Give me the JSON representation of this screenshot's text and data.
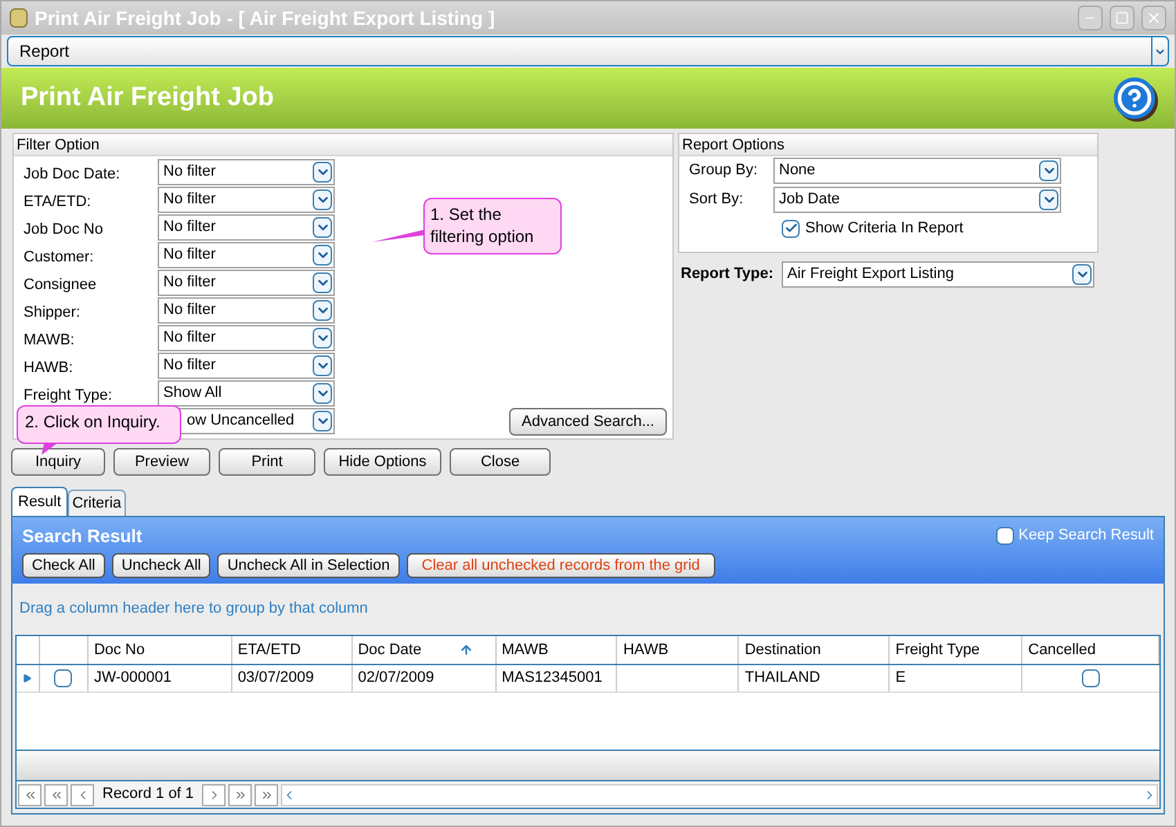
{
  "window": {
    "title": "Print Air Freight Job - [ Air Freight Export Listing ]"
  },
  "menu": {
    "value": "Report"
  },
  "banner": {
    "title": "Print Air Freight Job"
  },
  "filter_option": {
    "title": "Filter Option",
    "filters": [
      {
        "label": "Job Doc Date:",
        "value": "No filter"
      },
      {
        "label": "ETA/ETD:",
        "value": "No filter"
      },
      {
        "label": "Job Doc No",
        "value": "No filter"
      },
      {
        "label": "Customer:",
        "value": "No filter"
      },
      {
        "label": "Consignee",
        "value": "No filter"
      },
      {
        "label": "Shipper:",
        "value": "No filter"
      },
      {
        "label": "MAWB:",
        "value": "No filter"
      },
      {
        "label": "HAWB:",
        "value": "No filter"
      },
      {
        "label": "Freight Type:",
        "value": "Show All"
      },
      {
        "value": "ow Uncancelled"
      }
    ],
    "advanced_button": "Advanced Search..."
  },
  "report_options": {
    "title": "Report Options",
    "group_by": {
      "label": "Group By:",
      "value": "None"
    },
    "sort_by": {
      "label": "Sort By:",
      "value": "Job Date"
    },
    "show_criteria": {
      "label": "Show Criteria In Report",
      "checked": true
    }
  },
  "report_type": {
    "label": "Report Type:",
    "value": "Air Freight Export Listing"
  },
  "actions": [
    "Inquiry",
    "Preview",
    "Print",
    "Hide Options",
    "Close"
  ],
  "callouts": [
    {
      "text": "1. Set the filtering option"
    },
    {
      "text": "2. Click on Inquiry."
    }
  ],
  "tabs": [
    {
      "label": "Result",
      "selected": true
    },
    {
      "label": "Criteria",
      "selected": false
    }
  ],
  "search_result": {
    "title": "Search Result",
    "keep": {
      "label": "Keep Search Result",
      "checked": false
    },
    "buttons": [
      {
        "label": "Check All",
        "kind": "normal"
      },
      {
        "label": "Uncheck All",
        "kind": "normal"
      },
      {
        "label": "Uncheck All in Selection",
        "kind": "normal"
      },
      {
        "label": "Clear all unchecked records from the grid",
        "kind": "danger"
      }
    ],
    "group_hint": "Drag a column header here to group by that column",
    "table": {
      "columns": [
        {
          "label": "Doc No",
          "sorted": false
        },
        {
          "label": "ETA/ETD",
          "sorted": false
        },
        {
          "label": "Doc Date",
          "sorted": true
        },
        {
          "label": "MAWB",
          "sorted": false
        },
        {
          "label": "HAWB",
          "sorted": false
        },
        {
          "label": "Destination",
          "sorted": false
        },
        {
          "label": "Freight Type",
          "sorted": false
        },
        {
          "label": "Cancelled",
          "sorted": false
        }
      ],
      "rows": [
        {
          "current": true,
          "checked": false,
          "doc_no": "JW-000001",
          "eta_etd": "03/07/2009",
          "doc_date": "02/07/2009",
          "mawb": "MAS12345001",
          "destination": "THAILAND",
          "freight_type": "E",
          "cancelled": false
        }
      ]
    },
    "pager": {
      "text": "Record 1 of 1"
    }
  }
}
